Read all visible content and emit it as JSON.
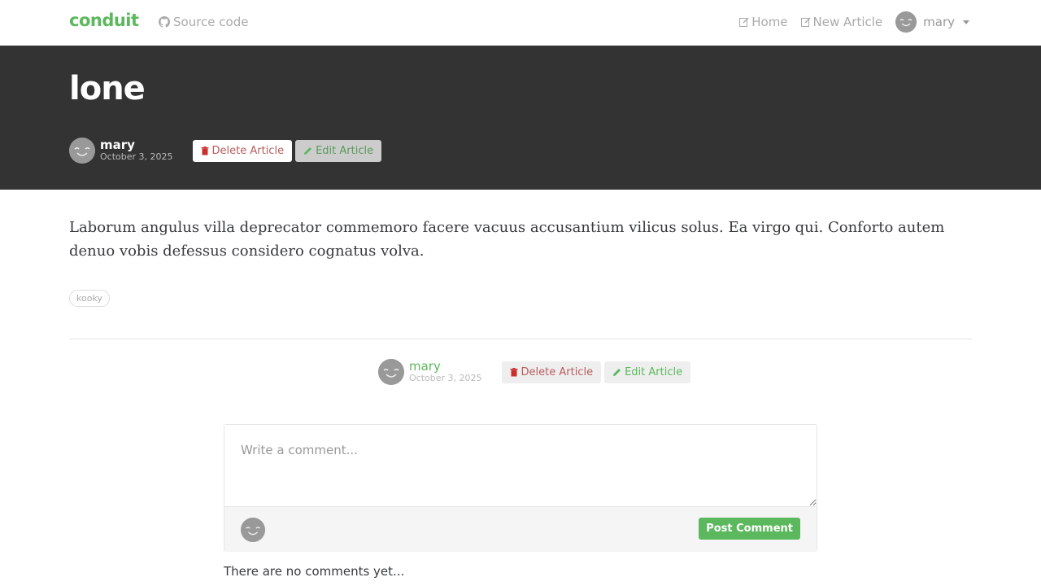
{
  "nav": {
    "brand": "conduit",
    "source_label": "Source code",
    "home_label": "Home",
    "new_article_label": "New Article",
    "user_name": "mary"
  },
  "article": {
    "title": "lone",
    "author": "mary",
    "date": "October 3, 2025",
    "body": "Laborum angulus villa deprecator commemoro facere vacuus accusantium vilicus solus. Ea virgo qui. Conforto autem denuo vobis defessus considero cognatus volva.",
    "tags": [
      "kooky"
    ],
    "delete_label": "Delete Article",
    "edit_label": "Edit Article"
  },
  "comments": {
    "placeholder": "Write a comment...",
    "post_label": "Post Comment",
    "empty_text": "There are no comments yet..."
  },
  "colors": {
    "brand": "#5cb85c",
    "banner_bg": "#333333",
    "danger": "#b85c5c"
  }
}
